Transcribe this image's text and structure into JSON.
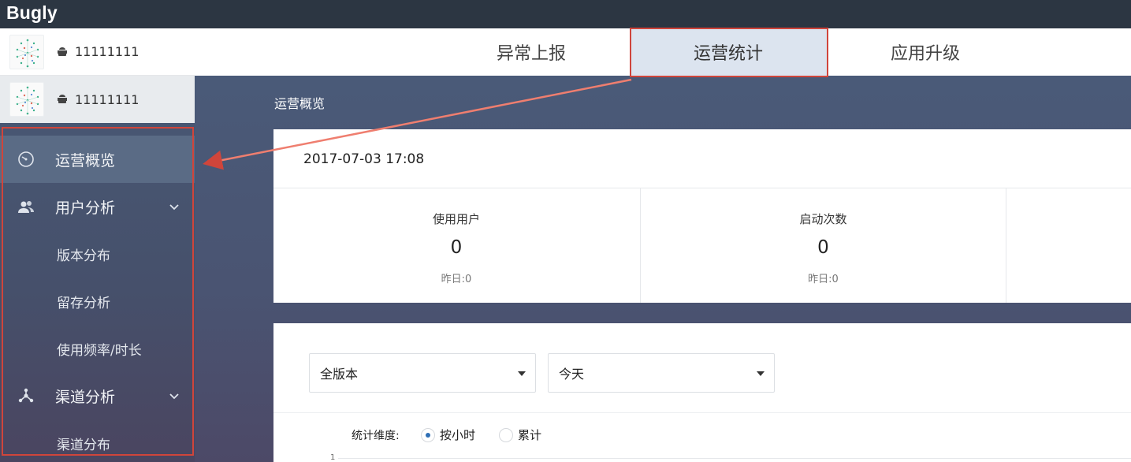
{
  "brand": "Bugly",
  "apps": [
    {
      "name": "11111111"
    },
    {
      "name": "11111111"
    }
  ],
  "nav": {
    "items": [
      {
        "label": "运营概览",
        "icon": "dashboard-icon"
      },
      {
        "label": "用户分析",
        "icon": "users-icon"
      },
      {
        "label": "版本分布"
      },
      {
        "label": "留存分析"
      },
      {
        "label": "使用频率/时长"
      },
      {
        "label": "渠道分析",
        "icon": "channel-icon"
      },
      {
        "label": "渠道分布"
      }
    ]
  },
  "tabs": [
    {
      "label": "异常上报"
    },
    {
      "label": "运营统计"
    },
    {
      "label": "应用升级"
    }
  ],
  "main": {
    "section_title": "运营概览",
    "datetime": "2017-07-03 17:08",
    "metrics": [
      {
        "label": "使用用户",
        "value": "0",
        "prev": "昨日:0"
      },
      {
        "label": "启动次数",
        "value": "0",
        "prev": "昨日:0"
      }
    ],
    "filters": {
      "version": "全版本",
      "period": "今天"
    },
    "dimension": {
      "label": "统计维度:",
      "options": [
        {
          "label": "按小时",
          "selected": true
        },
        {
          "label": "累计",
          "selected": false
        }
      ]
    },
    "chart_tick": "1"
  },
  "colors": {
    "topbar": "#2c3642",
    "sidebar": "#495a76",
    "active_tab": "#dce4ef",
    "highlight": "#d0453b",
    "radio_dot": "#2f6fb5"
  }
}
